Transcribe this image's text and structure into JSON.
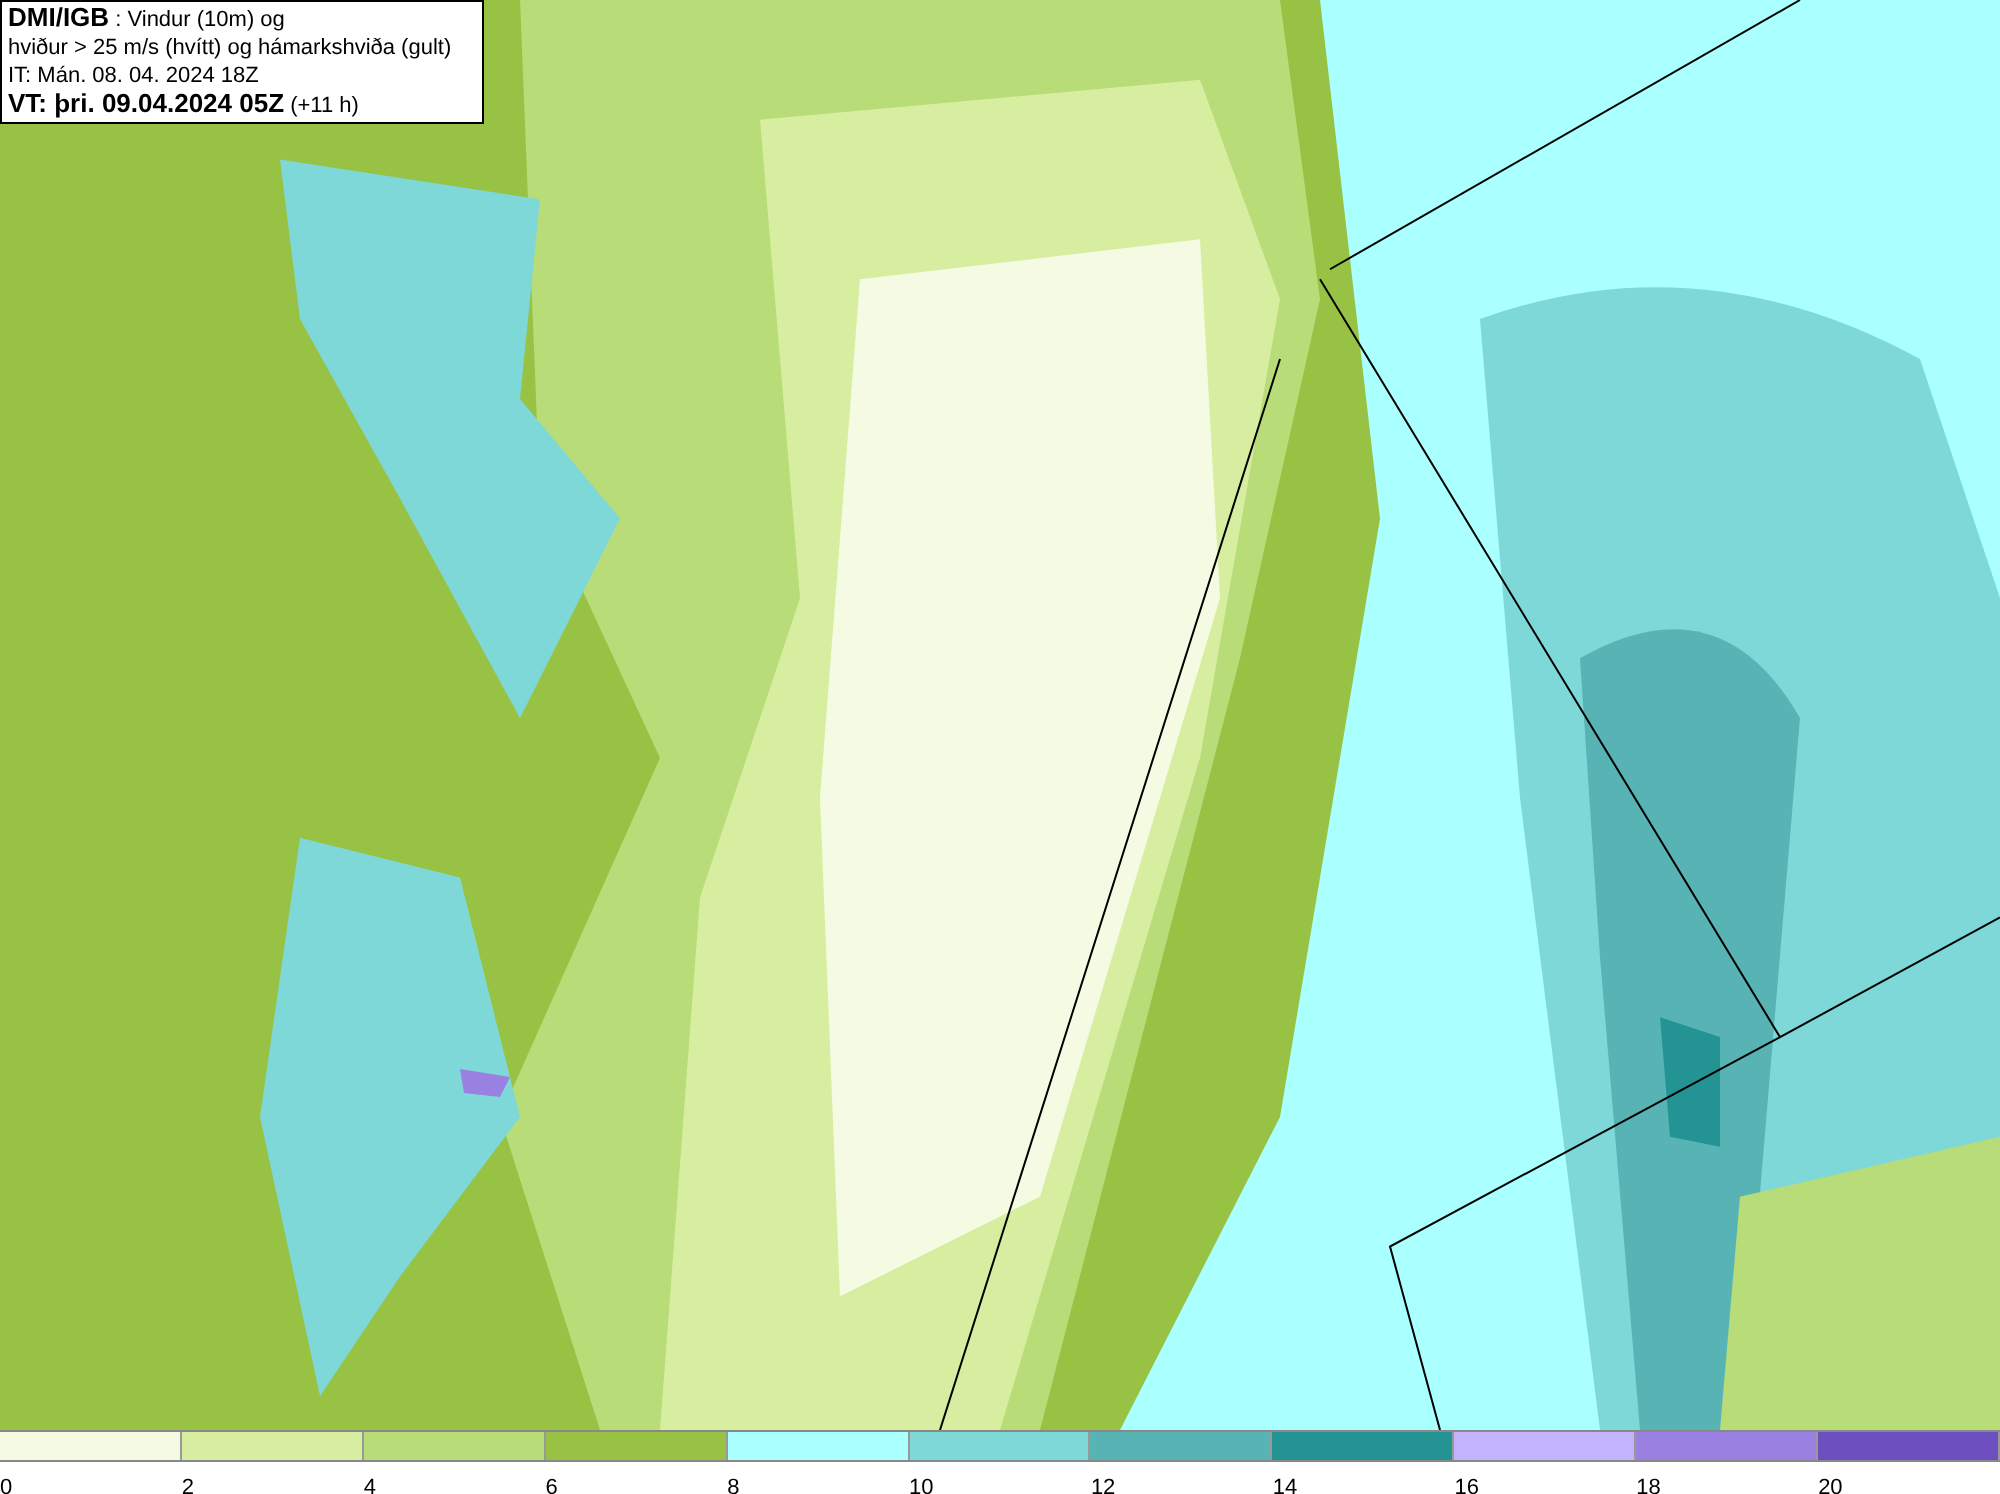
{
  "title_box": {
    "lines": [
      "**DMI/IGB** : Vindur (10m) og",
      "hviður > 25 m/s (hvítt) og hámarkshviða (gult)",
      "IT: Mán. 08. 04. 2024 18Z",
      "**VT: þri. 09.04.2024 05Z** (+11 h)"
    ]
  },
  "legend": {
    "bins": [
      {
        "color": "#f5fbe3",
        "label": "0"
      },
      {
        "color": "#d7eea0",
        "label": "2"
      },
      {
        "color": "#b8dc78",
        "label": "4"
      },
      {
        "color": "#97c244",
        "label": "6"
      },
      {
        "color": "#aaffff",
        "label": "8"
      },
      {
        "color": "#7fd8d8",
        "label": "10"
      },
      {
        "color": "#58b4b4",
        "label": "12"
      },
      {
        "color": "#239393",
        "label": "14"
      },
      {
        "color": "#c3b2fc",
        "label": "16"
      },
      {
        "color": "#9a80e0",
        "label": "18"
      },
      {
        "color": "#6e4fc0",
        "label": "20"
      }
    ]
  }
}
